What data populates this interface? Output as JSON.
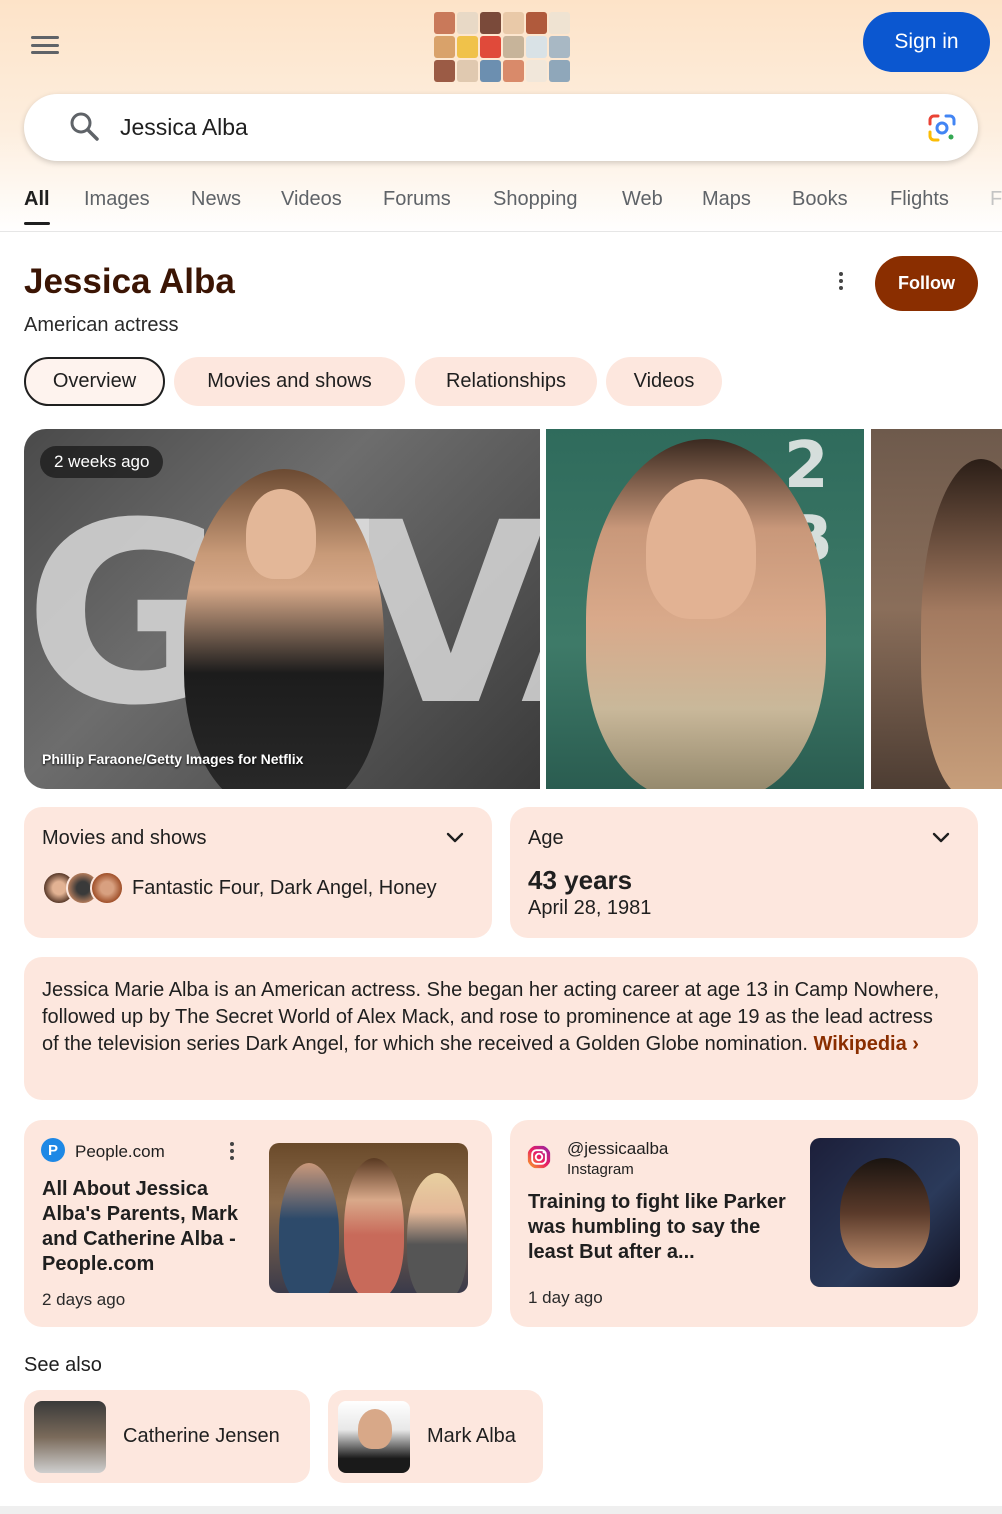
{
  "header": {
    "menu_icon": "hamburger-menu-icon",
    "doodle_icon": "google-doodle-logo",
    "signin_label": "Sign in"
  },
  "search": {
    "query": "Jessica Alba",
    "search_icon": "search-icon",
    "lens_icon": "google-lens-icon"
  },
  "tabs": [
    "All",
    "Images",
    "News",
    "Videos",
    "Forums",
    "Shopping",
    "Web",
    "Maps",
    "Books",
    "Flights",
    "F"
  ],
  "knowledge_panel": {
    "title": "Jessica Alba",
    "subtitle": "American actress",
    "follow_label": "Follow",
    "more_icon": "more-vertical-icon",
    "chips": [
      "Overview",
      "Movies and shows",
      "Relationships",
      "Videos"
    ],
    "photo_badge": "2 weeks ago",
    "photo_credit": "Phillip Faraone/Getty Images for Netflix"
  },
  "cards": {
    "movies": {
      "title": "Movies and shows",
      "text": "Fantastic Four, Dark Angel, Honey"
    },
    "age": {
      "title": "Age",
      "value": "43 years",
      "date": "April 28, 1981"
    }
  },
  "description": {
    "text": "Jessica Marie Alba is an American actress. She began her acting career at age 13 in Camp Nowhere, followed up by The Secret World of Alex Mack, and rose to prominence at age 19 as the lead actress of the television series Dark Angel, for which she received a Golden Globe nomination.",
    "link": "Wikipedia",
    "link_arrow": "›"
  },
  "news": [
    {
      "source": "People.com",
      "source_letter": "P",
      "headline": "All About Jessica Alba's Parents, Mark and Catherine Alba - People.com",
      "time": "2 days ago"
    },
    {
      "source": "@jessicaalba",
      "platform": "Instagram",
      "headline": "Training to fight like Parker was humbling to say the least But after a...",
      "time": "1 day ago"
    }
  ],
  "see_also": {
    "title": "See also",
    "people": [
      "Catherine Jensen",
      "Mark Alba"
    ]
  },
  "colors": {
    "accent": "#8a2e00",
    "signin": "#0b57d0",
    "card_bg": "#fde7de",
    "title": "#3b1504"
  }
}
